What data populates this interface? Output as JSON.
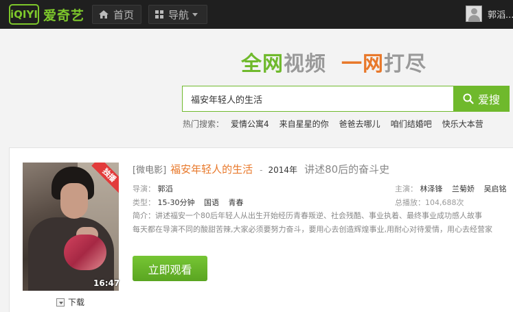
{
  "header": {
    "logo_badge": "iQIYI",
    "logo_text": "爱奇艺",
    "home_label": "首页",
    "guide_label": "导航",
    "user_name": "郭滔..."
  },
  "slogan": {
    "part1": "全网",
    "part2": "视频",
    "part3": "一网",
    "part4": "打尽"
  },
  "search": {
    "value": "福安年轻人的生活",
    "button_label": "爱搜"
  },
  "hot_searches": {
    "label": "热门搜索：",
    "items": [
      "爱情公寓4",
      "来自星星的你",
      "爸爸去哪儿",
      "咱们结婚吧",
      "快乐大本营"
    ]
  },
  "result": {
    "badge": "独播",
    "duration": "16:47",
    "download_label": "下载",
    "type_tag": "[微电影]",
    "title": "福安年轻人的生活",
    "dash": "-",
    "year": "2014年",
    "tagline": "讲述80后的奋斗史",
    "director_label": "导演：",
    "director": "郭滔",
    "category_label": "类型：",
    "categories": [
      "15-30分钟",
      "国语",
      "青春"
    ],
    "actors_label": "主演：",
    "actors": [
      "林泽锋",
      "兰菊娇",
      "吴启铭"
    ],
    "plays_label": "总播放：",
    "plays": "104,688次",
    "description_label": "简介：",
    "description_line1": "讲述福安一个80后年轻人从出生开始经历青春叛逆、社会残酷、事业执着、最终事业成功感人故事",
    "description_line2": "每天都在导演不同的酸甜苦辣,大家必须要努力奋斗，要用心去创造辉煌事业,用耐心对待爱情，用心去经营家",
    "play_button": "立即观看"
  },
  "colors": {
    "brand_green": "#6fb92c",
    "accent_orange": "#e8782a",
    "exclusive_red": "#e23b3b"
  }
}
